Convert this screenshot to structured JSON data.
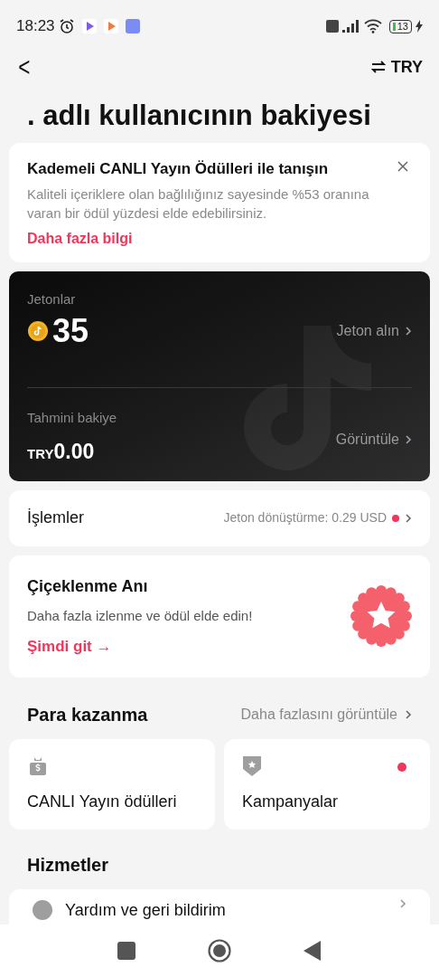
{
  "status_bar": {
    "time": "18:23",
    "battery": "13"
  },
  "header": {
    "back": "<",
    "currency": "TRY"
  },
  "title": ". adlı kullanıcının bakiyesi",
  "notice": {
    "title": "Kademeli CANLI Yayın Ödülleri ile tanışın",
    "body": "Kaliteli içeriklere olan bağlılığınız sayesinde %53 oranına varan bir ödül yüzdesi elde edebilirsiniz.",
    "link": "Daha fazla bilgi"
  },
  "balance": {
    "coins_label": "Jetonlar",
    "coins": "35",
    "coins_action": "Jeton alın",
    "estimate_label": "Tahmini bakiye",
    "estimate_currency": "TRY",
    "estimate_value": "0.00",
    "estimate_action": "Görüntüle"
  },
  "transactions": {
    "label": "İşlemler",
    "detail": "Jeton dönüştürme: 0.29 USD",
    "has_dot": true
  },
  "promo": {
    "title": "Çiçeklenme Anı",
    "body": "Daha fazla izlenme ve ödül elde edin!",
    "link": "Şimdi git →"
  },
  "monetization": {
    "title": "Para kazanma",
    "more": "Daha fazlasını görüntüle",
    "tiles": [
      {
        "kind": "money",
        "label": "CANLI Yayın ödülleri",
        "has_dot": false
      },
      {
        "kind": "badge",
        "label": "Kampanyalar",
        "has_dot": true
      }
    ]
  },
  "services": {
    "title": "Hizmetler",
    "items": [
      {
        "label": "Yardım ve geri bildirim"
      }
    ]
  }
}
